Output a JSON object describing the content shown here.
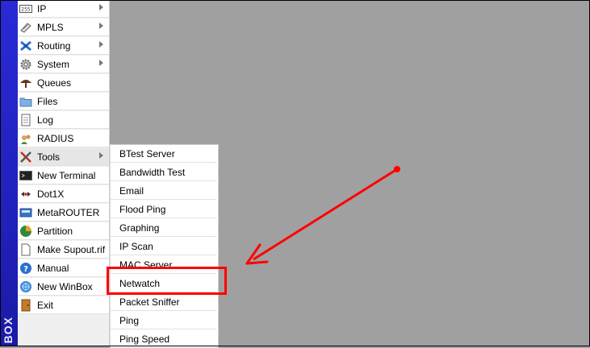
{
  "brand": {
    "text": "BOX"
  },
  "menu": {
    "items": [
      {
        "label": "IP",
        "icon": "ip-icon",
        "has_submenu": true
      },
      {
        "label": "MPLS",
        "icon": "mpls-icon",
        "has_submenu": true
      },
      {
        "label": "Routing",
        "icon": "routing-icon",
        "has_submenu": true
      },
      {
        "label": "System",
        "icon": "system-gear-icon",
        "has_submenu": true
      },
      {
        "label": "Queues",
        "icon": "queues-icon",
        "has_submenu": false
      },
      {
        "label": "Files",
        "icon": "folder-icon",
        "has_submenu": false
      },
      {
        "label": "Log",
        "icon": "log-icon",
        "has_submenu": false
      },
      {
        "label": "RADIUS",
        "icon": "radius-icon",
        "has_submenu": false
      },
      {
        "label": "Tools",
        "icon": "tools-icon",
        "has_submenu": true
      },
      {
        "label": "New Terminal",
        "icon": "terminal-icon",
        "has_submenu": false
      },
      {
        "label": "Dot1X",
        "icon": "dot1x-icon",
        "has_submenu": false
      },
      {
        "label": "MetaROUTER",
        "icon": "metarouter-icon",
        "has_submenu": false
      },
      {
        "label": "Partition",
        "icon": "partition-icon",
        "has_submenu": false
      },
      {
        "label": "Make Supout.rif",
        "icon": "supout-icon",
        "has_submenu": false
      },
      {
        "label": "Manual",
        "icon": "help-icon",
        "has_submenu": false
      },
      {
        "label": "New WinBox",
        "icon": "winbox-icon",
        "has_submenu": false
      },
      {
        "label": "Exit",
        "icon": "exit-icon",
        "has_submenu": false
      }
    ]
  },
  "tools_submenu": {
    "items": [
      {
        "label": "BTest Server"
      },
      {
        "label": "Bandwidth Test"
      },
      {
        "label": "Email"
      },
      {
        "label": "Flood Ping"
      },
      {
        "label": "Graphing"
      },
      {
        "label": "IP Scan"
      },
      {
        "label": "MAC Server"
      },
      {
        "label": "Netwatch"
      },
      {
        "label": "Packet Sniffer"
      },
      {
        "label": "Ping"
      },
      {
        "label": "Ping Speed"
      }
    ]
  },
  "annotation": {
    "color": "#ff0000",
    "target": "Netwatch"
  },
  "colors": {
    "brand_strip": "#2020c0",
    "workspace": "#a0a0a0",
    "menu_bg": "#ffffff"
  }
}
